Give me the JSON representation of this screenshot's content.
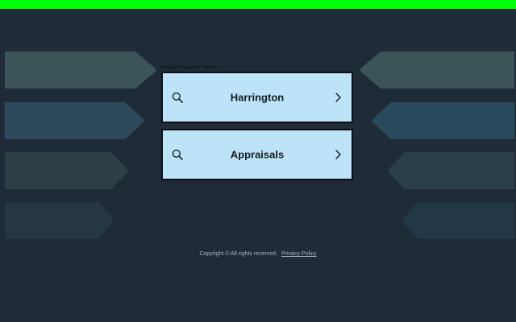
{
  "header": {
    "accent_color": "#00ff00"
  },
  "background": {
    "color": "#1f2b36",
    "left_arrows": [
      "#3a5457",
      "#2c4a5b",
      "#2b3f45",
      "#253744"
    ],
    "right_arrows": [
      "#3a5457",
      "#274a5c",
      "#2a3f47",
      "#233847"
    ]
  },
  "related": {
    "label": "Related Search Topics",
    "card_color": "#bde3f8",
    "items": [
      {
        "label": "Harrington"
      },
      {
        "label": "Appraisals"
      }
    ]
  },
  "footer": {
    "copyright": "Copyright ©  All rights reserved.",
    "privacy_link": "Privacy Policy"
  }
}
